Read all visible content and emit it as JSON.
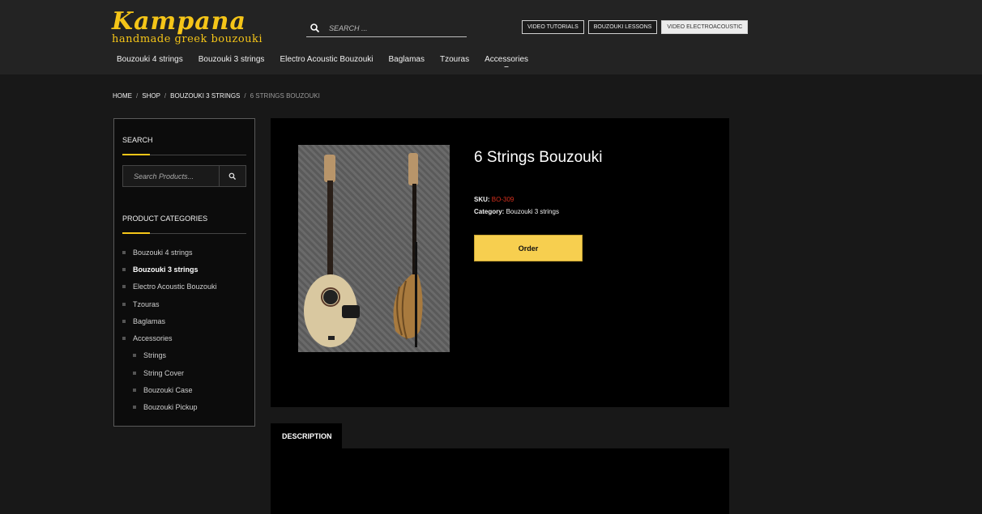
{
  "header": {
    "logo_main": "Kampana",
    "logo_sub": "handmade greek bouzouki",
    "search_placeholder": "SEARCH ...",
    "buttons": [
      "VIDEO TUTORIALS",
      "BOUZOUKI LESSONS",
      "VIDEO ELECTROACOUSTIC"
    ],
    "nav": [
      "Bouzouki 4 strings",
      "Bouzouki 3 strings",
      "Electro Acoustic Bouzouki",
      "Baglamas",
      "Tzouras",
      "Accessories"
    ]
  },
  "breadcrumb": {
    "home": "HOME",
    "shop": "SHOP",
    "category": "BOUZOUKI 3 STRINGS",
    "current": "6 STRINGS BOUZOUKI",
    "separator": "/"
  },
  "sidebar": {
    "search_title": "SEARCH",
    "search_placeholder": "Search Products...",
    "categories_title": "PRODUCT CATEGORIES",
    "categories": [
      "Bouzouki 4 strings",
      "Bouzouki 3 strings",
      "Electro Acoustic Bouzouki",
      "Tzouras",
      "Baglamas",
      "Accessories",
      "Strings",
      "String Cover",
      "Bouzouki Case",
      "Bouzouki Pickup"
    ]
  },
  "product": {
    "title": "6 Strings Bouzouki",
    "sku_label": "SKU:",
    "sku": "BO-309",
    "category_label": "Category:",
    "category": "Bouzouki 3 strings",
    "order_label": "Order"
  },
  "tabs": {
    "description": "DESCRIPTION"
  },
  "colors": {
    "accent": "#f5c518",
    "order_button": "#f7cf4f",
    "sku": "#d9301e"
  }
}
